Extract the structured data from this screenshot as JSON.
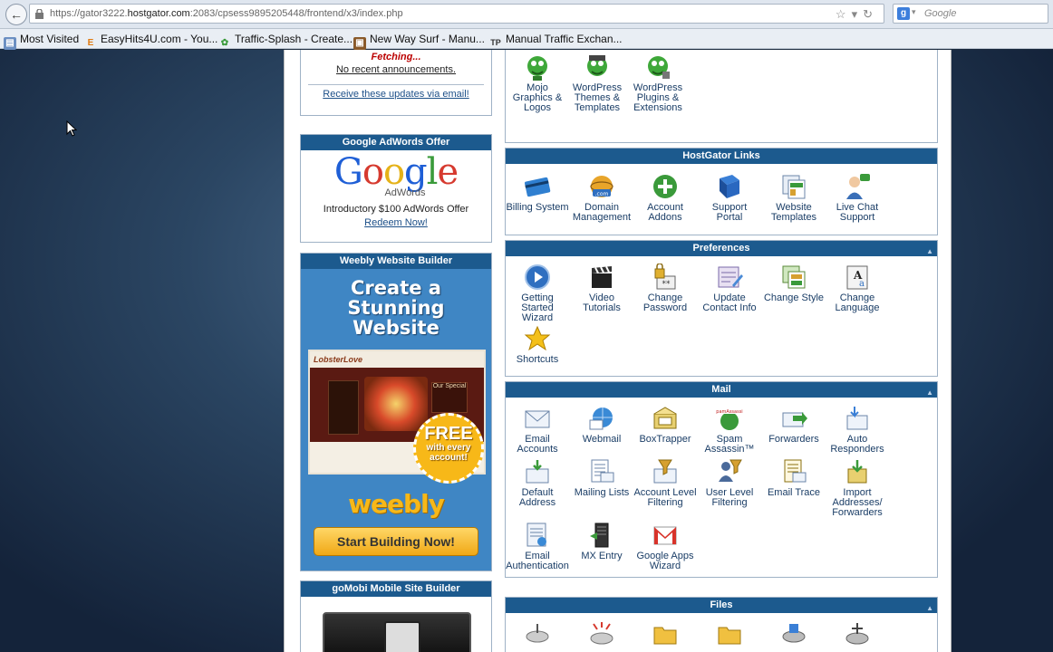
{
  "browser": {
    "url_prefix": "https://gator3222.",
    "url_host": "hostgator.com",
    "url_rest": ":2083/cpsess9895205448/frontend/x3/index.php",
    "search_placeholder": "Google",
    "bookmarks": [
      {
        "label": "Most Visited",
        "icon": "bookmark-icon"
      },
      {
        "label": "EasyHits4U.com - You...",
        "icon": "easyhits-icon"
      },
      {
        "label": "Traffic-Splash - Create...",
        "icon": "traffic-splash-icon"
      },
      {
        "label": "New Way Surf - Manu...",
        "icon": "newway-icon"
      },
      {
        "label": "Manual Traffic Exchan...",
        "icon": "tp-icon"
      }
    ]
  },
  "news": {
    "fetching": "Fetching...",
    "no_announcements": "No recent announcements.",
    "email_link": "Receive these updates via email!"
  },
  "adwords": {
    "title": "Google AdWords Offer",
    "logo": "Google",
    "logo_sub": "AdWords",
    "offer": "Introductory $100 AdWords Offer",
    "link": "Redeem Now!"
  },
  "weebly": {
    "title": "Weebly Website Builder",
    "headline_1": "Create a",
    "headline_2": "Stunning",
    "headline_3": "Website",
    "screenshot_title": "LobsterLove",
    "screenshot_special": "Our Special",
    "badge_1": "FREE",
    "badge_2": "with every",
    "badge_3": "account!",
    "logo": "weebly",
    "button": "Start Building Now!"
  },
  "gomobi": {
    "title": "goMobi Mobile Site Builder"
  },
  "software": {
    "items": [
      {
        "label": "Mojo Graphics & Logos",
        "icon": "mojo-graphics-icon"
      },
      {
        "label": "WordPress Themes & Templates",
        "icon": "wordpress-themes-icon"
      },
      {
        "label": "WordPress Plugins & Extensions",
        "icon": "wordpress-plugins-icon"
      }
    ]
  },
  "hostgator_links": {
    "title": "HostGator Links",
    "items": [
      {
        "label": "Billing System",
        "icon": "billing-card-icon"
      },
      {
        "label": "Domain Management",
        "icon": "domain-globe-icon"
      },
      {
        "label": "Account Addons",
        "icon": "add-plus-icon"
      },
      {
        "label": "Support Portal",
        "icon": "support-book-icon"
      },
      {
        "label": "Website Templates",
        "icon": "templates-icon"
      },
      {
        "label": "Live Chat Support",
        "icon": "live-chat-icon"
      }
    ]
  },
  "preferences": {
    "title": "Preferences",
    "items": [
      {
        "label": "Getting Started Wizard",
        "icon": "play-icon"
      },
      {
        "label": "Video Tutorials",
        "icon": "clapper-icon"
      },
      {
        "label": "Change Password",
        "icon": "password-lock-icon"
      },
      {
        "label": "Update Contact Info",
        "icon": "contact-icon"
      },
      {
        "label": "Change Style",
        "icon": "style-icon"
      },
      {
        "label": "Change Language",
        "icon": "language-icon"
      },
      {
        "label": "Shortcuts",
        "icon": "star-icon"
      }
    ]
  },
  "mail": {
    "title": "Mail",
    "items": [
      {
        "label": "Email Accounts",
        "icon": "envelope-icon"
      },
      {
        "label": "Webmail",
        "icon": "webmail-icon"
      },
      {
        "label": "BoxTrapper",
        "icon": "boxtrapper-icon"
      },
      {
        "label": "Spam Assassin™",
        "icon": "spam-assassin-icon"
      },
      {
        "label": "Forwarders",
        "icon": "forwarders-icon"
      },
      {
        "label": "Auto Responders",
        "icon": "auto-responder-icon"
      },
      {
        "label": "Default Address",
        "icon": "default-address-icon"
      },
      {
        "label": "Mailing Lists",
        "icon": "mailing-list-icon"
      },
      {
        "label": "Account Level Filtering",
        "icon": "account-filter-icon"
      },
      {
        "label": "User Level Filtering",
        "icon": "user-filter-icon"
      },
      {
        "label": "Email Trace",
        "icon": "email-trace-icon"
      },
      {
        "label": "Import Addresses/ Forwarders",
        "icon": "import-icon"
      },
      {
        "label": "Email Authentication",
        "icon": "email-auth-icon"
      },
      {
        "label": "MX Entry",
        "icon": "mx-entry-icon"
      },
      {
        "label": "Google Apps Wizard",
        "icon": "gmail-icon"
      }
    ]
  },
  "files": {
    "title": "Files"
  },
  "colors": {
    "header_blue": "#1c5a8e",
    "link_blue": "#1c4f88",
    "weebly_blue": "#3f86c4"
  }
}
